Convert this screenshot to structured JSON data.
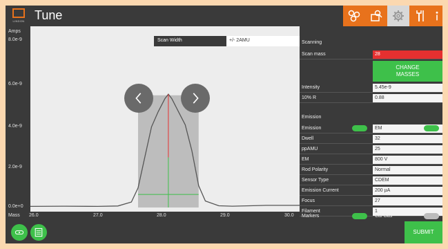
{
  "header": {
    "logo_text": "LINDON",
    "title": "Tune",
    "buttons": [
      {
        "icon": "molecules-icon",
        "color": "#e8721c"
      },
      {
        "icon": "search-document-icon",
        "color": "#e8721c"
      },
      {
        "icon": "gear-icon",
        "color": "#d8d8d8"
      },
      {
        "icon": "tools-icon",
        "color": "#e8721c"
      },
      {
        "icon": "info-icon",
        "color": "#e8721c"
      }
    ]
  },
  "plot": {
    "ylabel": "Amps",
    "yticks": [
      "8.0e-9",
      "6.0e-9",
      "4.0e-9",
      "2.0e-9",
      "0.0e+0"
    ],
    "xlabel": "Mass",
    "xticks": [
      "26.0",
      "27.0",
      "28.0",
      "29.0",
      "30.0"
    ],
    "scan_width_label": "Scan Width",
    "scan_width_value": "+/- 2AMU",
    "prev_icon": "chevron-left-icon",
    "next_icon": "chevron-right-icon"
  },
  "chart_data": {
    "type": "line",
    "ylabel": "Amps",
    "xlabel": "Mass",
    "xlim": [
      26.0,
      30.0
    ],
    "ylim": [
      0,
      8e-09
    ],
    "series": [
      {
        "x": [
          26.0,
          26.5,
          27.0,
          27.3,
          27.5,
          27.6,
          27.7,
          27.8,
          27.9,
          28.0,
          28.05,
          28.1,
          28.2,
          28.3,
          28.4,
          28.5,
          28.6,
          28.8,
          29.0,
          29.5,
          30.0
        ],
        "y": [
          5e-11,
          6e-11,
          5e-11,
          7e-11,
          2.5e-10,
          9e-10,
          2.3e-09,
          3.7e-09,
          4.4e-09,
          5e-09,
          5.2e-09,
          5e-09,
          4.4e-09,
          3.8e-09,
          2.6e-09,
          1e-09,
          3e-10,
          8e-11,
          6e-11,
          1e-10,
          1e-10
        ]
      }
    ],
    "highlight_peak_x": 28.05,
    "window": [
      27.6,
      28.5
    ]
  },
  "panel": {
    "scanning_title": "Scanning",
    "scan_mass_label": "Scan mass",
    "scan_mass_value": "28",
    "scan_mass_color": "#e53030",
    "change_masses_line1": "CHANGE",
    "change_masses_line2": "MASSES",
    "intensity_label": "Intensity",
    "intensity_value": "5.45e-9",
    "r10_label": "10% R",
    "r10_value": "0.88",
    "emission_title": "Emission",
    "rows": [
      {
        "label": "Emission",
        "value": "EM"
      },
      {
        "label": "Dwell",
        "value": "32"
      },
      {
        "label": "ppAMU",
        "value": "25"
      },
      {
        "label": "EM",
        "value": "800 V"
      },
      {
        "label": "Rod Polarity",
        "value": "Normal"
      },
      {
        "label": "Sensor Type",
        "value": "CDEM"
      },
      {
        "label": "Emission Current",
        "value": "200 µA"
      },
      {
        "label": "Focus",
        "value": "27"
      },
      {
        "label": "Filament",
        "value": "1"
      }
    ],
    "markers_label": "Markers",
    "cal_gas_label": "Cal Gas"
  },
  "footer": {
    "submit": "SUBMIT",
    "btn1_icon": "badge-icon",
    "btn2_icon": "list-icon"
  }
}
